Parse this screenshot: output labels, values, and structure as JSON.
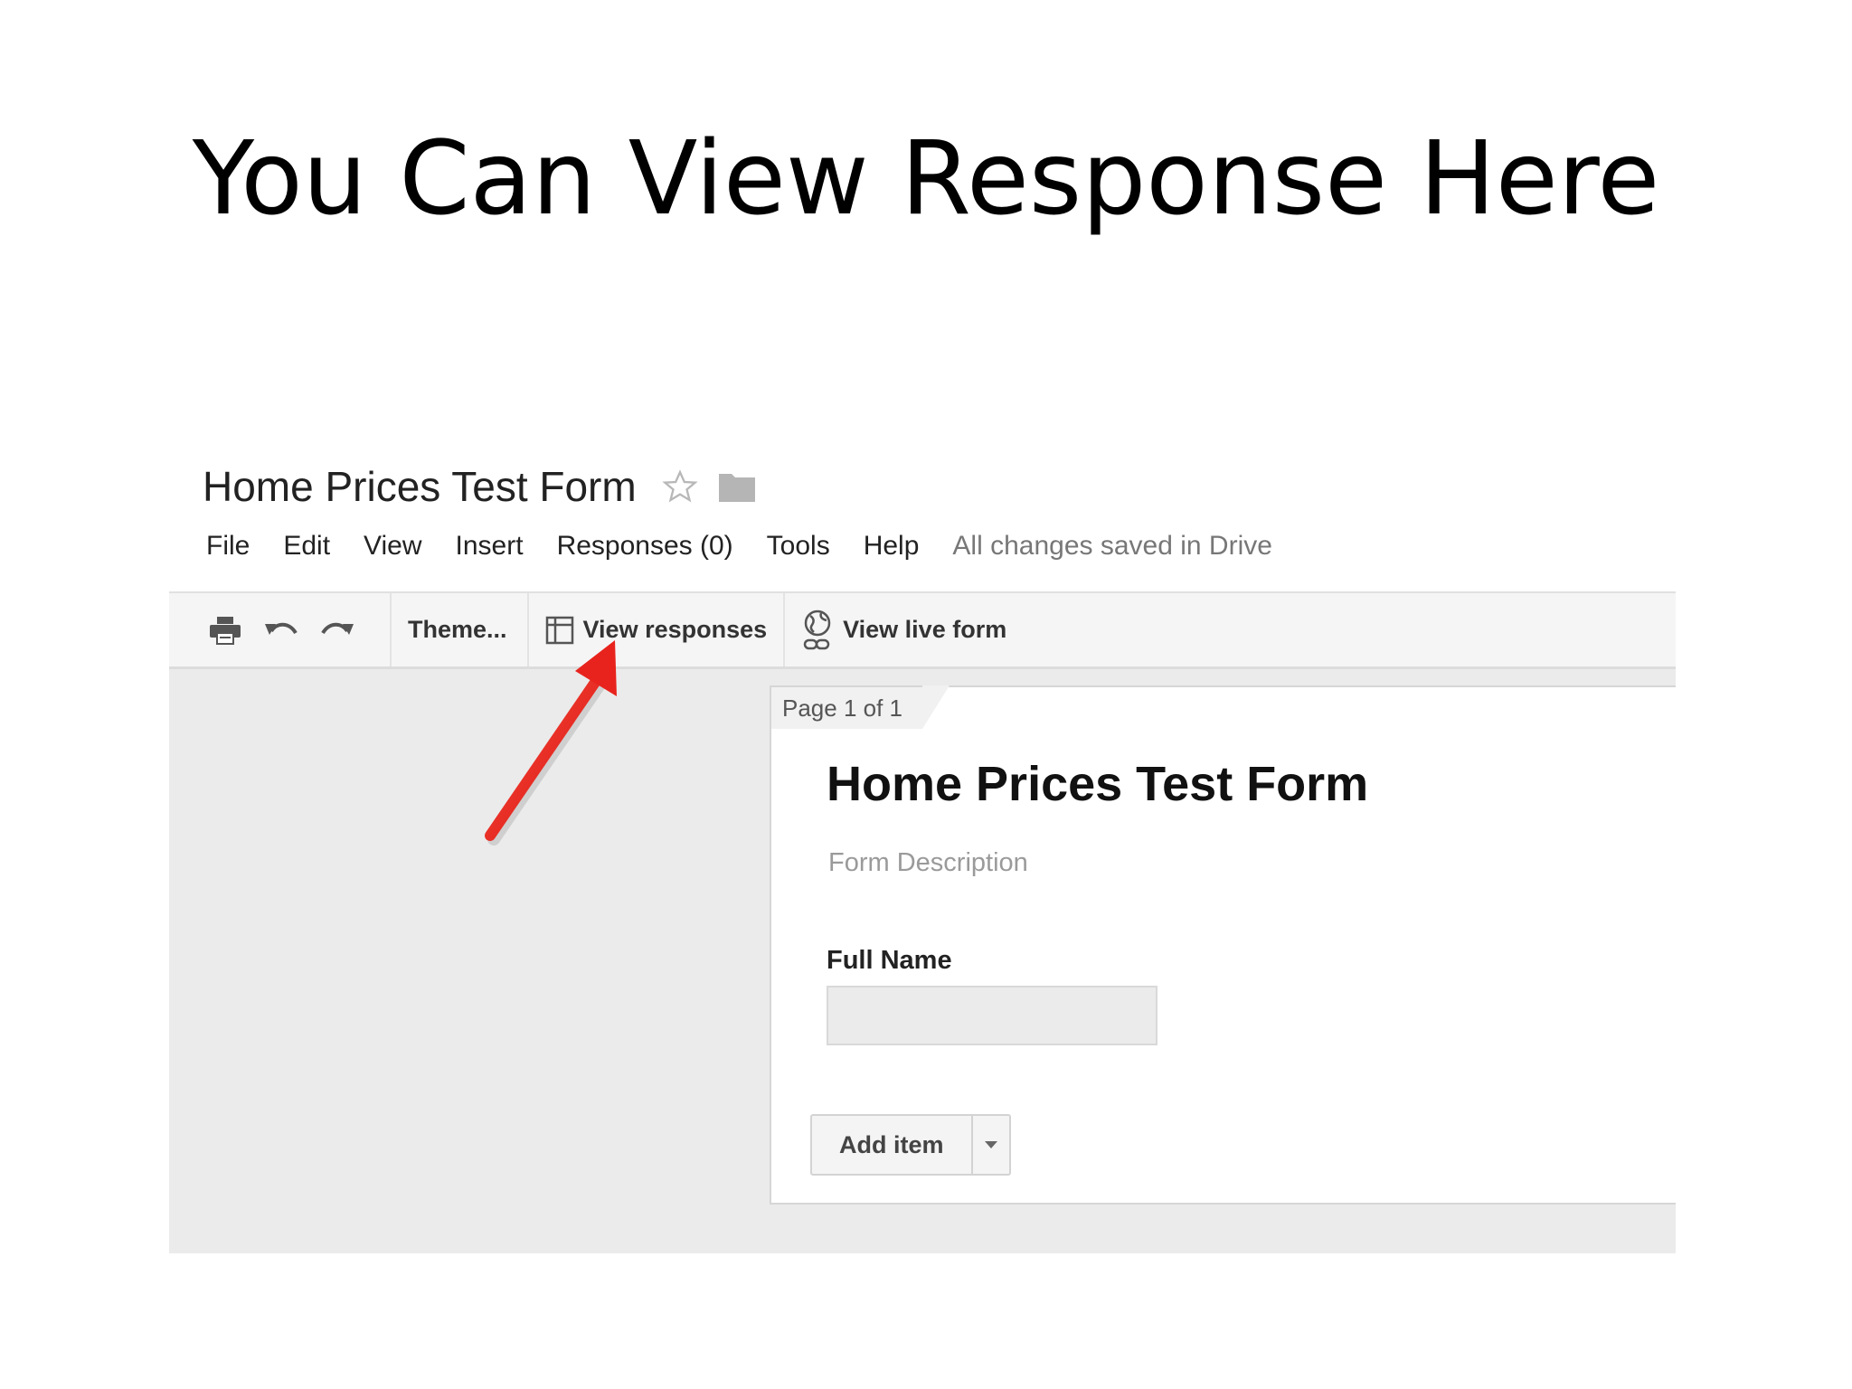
{
  "slide": {
    "title": "You Can View Response Here"
  },
  "document": {
    "title": "Home Prices Test Form"
  },
  "menu": {
    "items": [
      "File",
      "Edit",
      "View",
      "Insert",
      "Responses (0)",
      "Tools",
      "Help"
    ],
    "save_status": "All changes saved in Drive"
  },
  "toolbar": {
    "theme_label": "Theme...",
    "view_responses_label": "View responses",
    "view_live_form_label": "View live form"
  },
  "form": {
    "page_indicator": "Page 1 of 1",
    "title": "Home Prices Test Form",
    "description_placeholder": "Form Description",
    "fields": [
      {
        "label": "Full Name",
        "value": ""
      }
    ],
    "add_item_label": "Add item"
  },
  "colors": {
    "annotation_arrow": "#e8231d",
    "toolbar_bg": "#f5f5f5",
    "canvas_bg": "#ebebeb"
  },
  "icons": {
    "print": "printer-icon",
    "undo": "undo-icon",
    "redo": "redo-icon",
    "responses": "table-icon",
    "live_form": "globe-link-icon",
    "star": "star-icon",
    "folder": "folder-icon"
  }
}
